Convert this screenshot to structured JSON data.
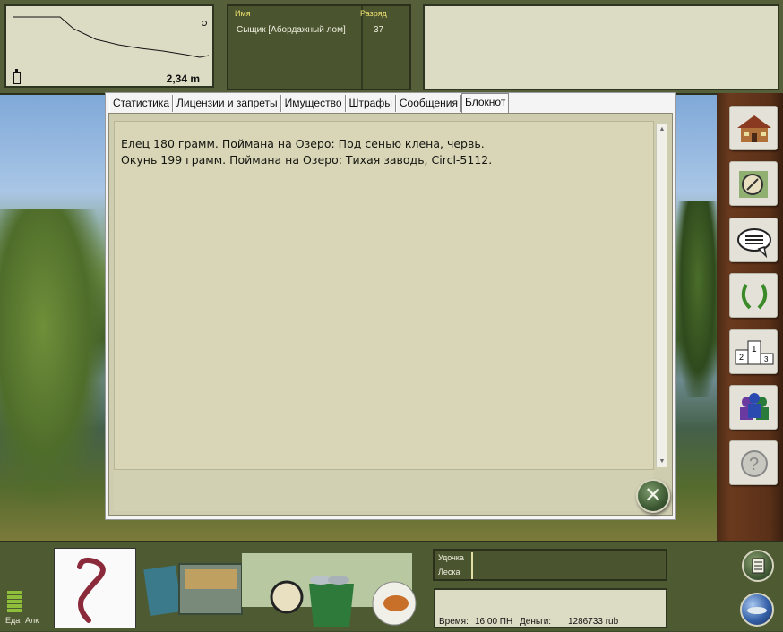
{
  "depth": {
    "value": "2,34 m"
  },
  "players": {
    "headers": {
      "name": "Имя",
      "rank": "Разряд"
    },
    "rows": [
      {
        "name": "Сыщик [Абордажный лом]",
        "rank": "37"
      }
    ]
  },
  "tabs": [
    {
      "label": "Статистика"
    },
    {
      "label": "Лицензии и запреты"
    },
    {
      "label": "Имущество"
    },
    {
      "label": "Штрафы"
    },
    {
      "label": "Сообщения"
    },
    {
      "label": "Блокнот",
      "active": true
    }
  ],
  "notebook": {
    "lines": [
      "Елец 180 грамм. Поймана на Озеро: Под сенью клена, червь.",
      "Окунь 199 грамм. Поймана на Озеро: Тихая заводь, Circl-5112."
    ]
  },
  "sidebar": {
    "icons": [
      "house-icon",
      "compass-map-icon",
      "chat-bubble-icon",
      "laurel-icon",
      "podium-icon",
      "players-group-icon",
      "help-question-icon"
    ]
  },
  "bottom": {
    "food_label": "Еда",
    "alc_label": "Алк",
    "rod_label": "Удочка",
    "line_label": "Леска",
    "time_label": "Время:",
    "time_value": "16:00 ПН",
    "money_label": "Деньги:",
    "money_value": "1286733 rub"
  },
  "colors": {
    "accent": "#f0e070",
    "panel": "#55603a",
    "paper": "#d8d6b7"
  }
}
